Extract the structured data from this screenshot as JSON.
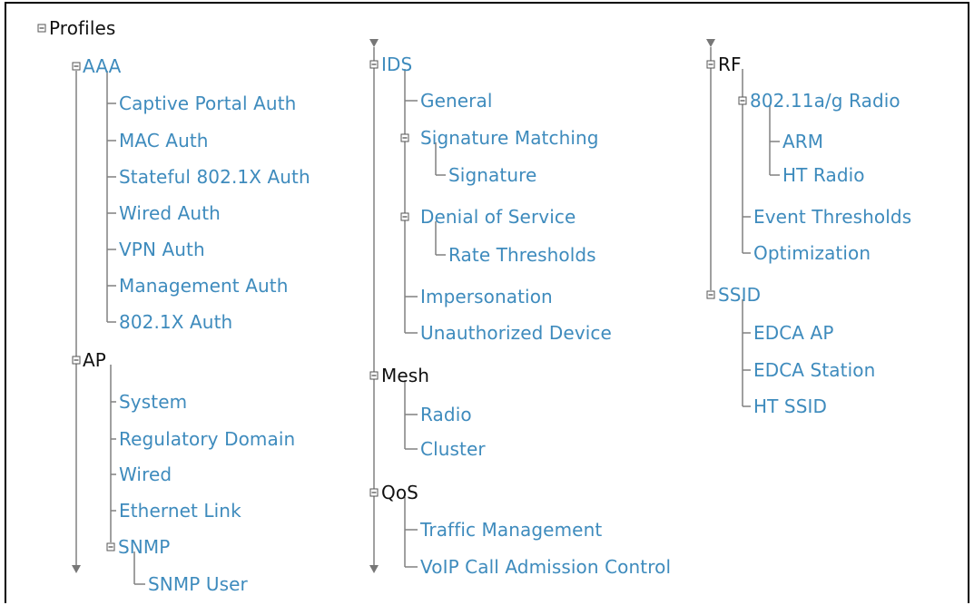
{
  "tree": {
    "profiles": "Profiles",
    "aaa": {
      "label": "AAA",
      "children": [
        "Captive Portal Auth",
        "MAC Auth",
        "Stateful 802.1X Auth",
        "Wired Auth",
        "VPN Auth",
        "Management Auth",
        "802.1X Auth"
      ]
    },
    "ap": {
      "label": "AP",
      "children": [
        "System",
        "Regulatory Domain",
        "Wired",
        "Ethernet Link"
      ],
      "snmp": {
        "label": "SNMP",
        "children": [
          "SNMP User"
        ]
      }
    },
    "ids": {
      "label": "IDS",
      "children": [
        "General",
        "Impersonation",
        "Unauthorized Device"
      ],
      "sig": {
        "label": "Signature Matching",
        "children": [
          "Signature"
        ]
      },
      "dos": {
        "label": "Denial of Service",
        "children": [
          "Rate Thresholds"
        ]
      }
    },
    "mesh": {
      "label": "Mesh",
      "children": [
        "Radio",
        "Cluster"
      ]
    },
    "qos": {
      "label": "QoS",
      "children": [
        "Traffic Management",
        "VoIP Call Admission Control"
      ]
    },
    "rf": {
      "label": "RF",
      "radio": {
        "label": "802.11a/g Radio",
        "children": [
          "ARM",
          "HT Radio"
        ]
      },
      "children": [
        "Event Thresholds",
        "Optimization"
      ]
    },
    "ssid": {
      "label": "SSID",
      "children": [
        "EDCA AP",
        "EDCA Station",
        "HT SSID"
      ]
    }
  },
  "colors": {
    "link": "#3e8bbd",
    "text": "#111111",
    "line": "#777777"
  }
}
